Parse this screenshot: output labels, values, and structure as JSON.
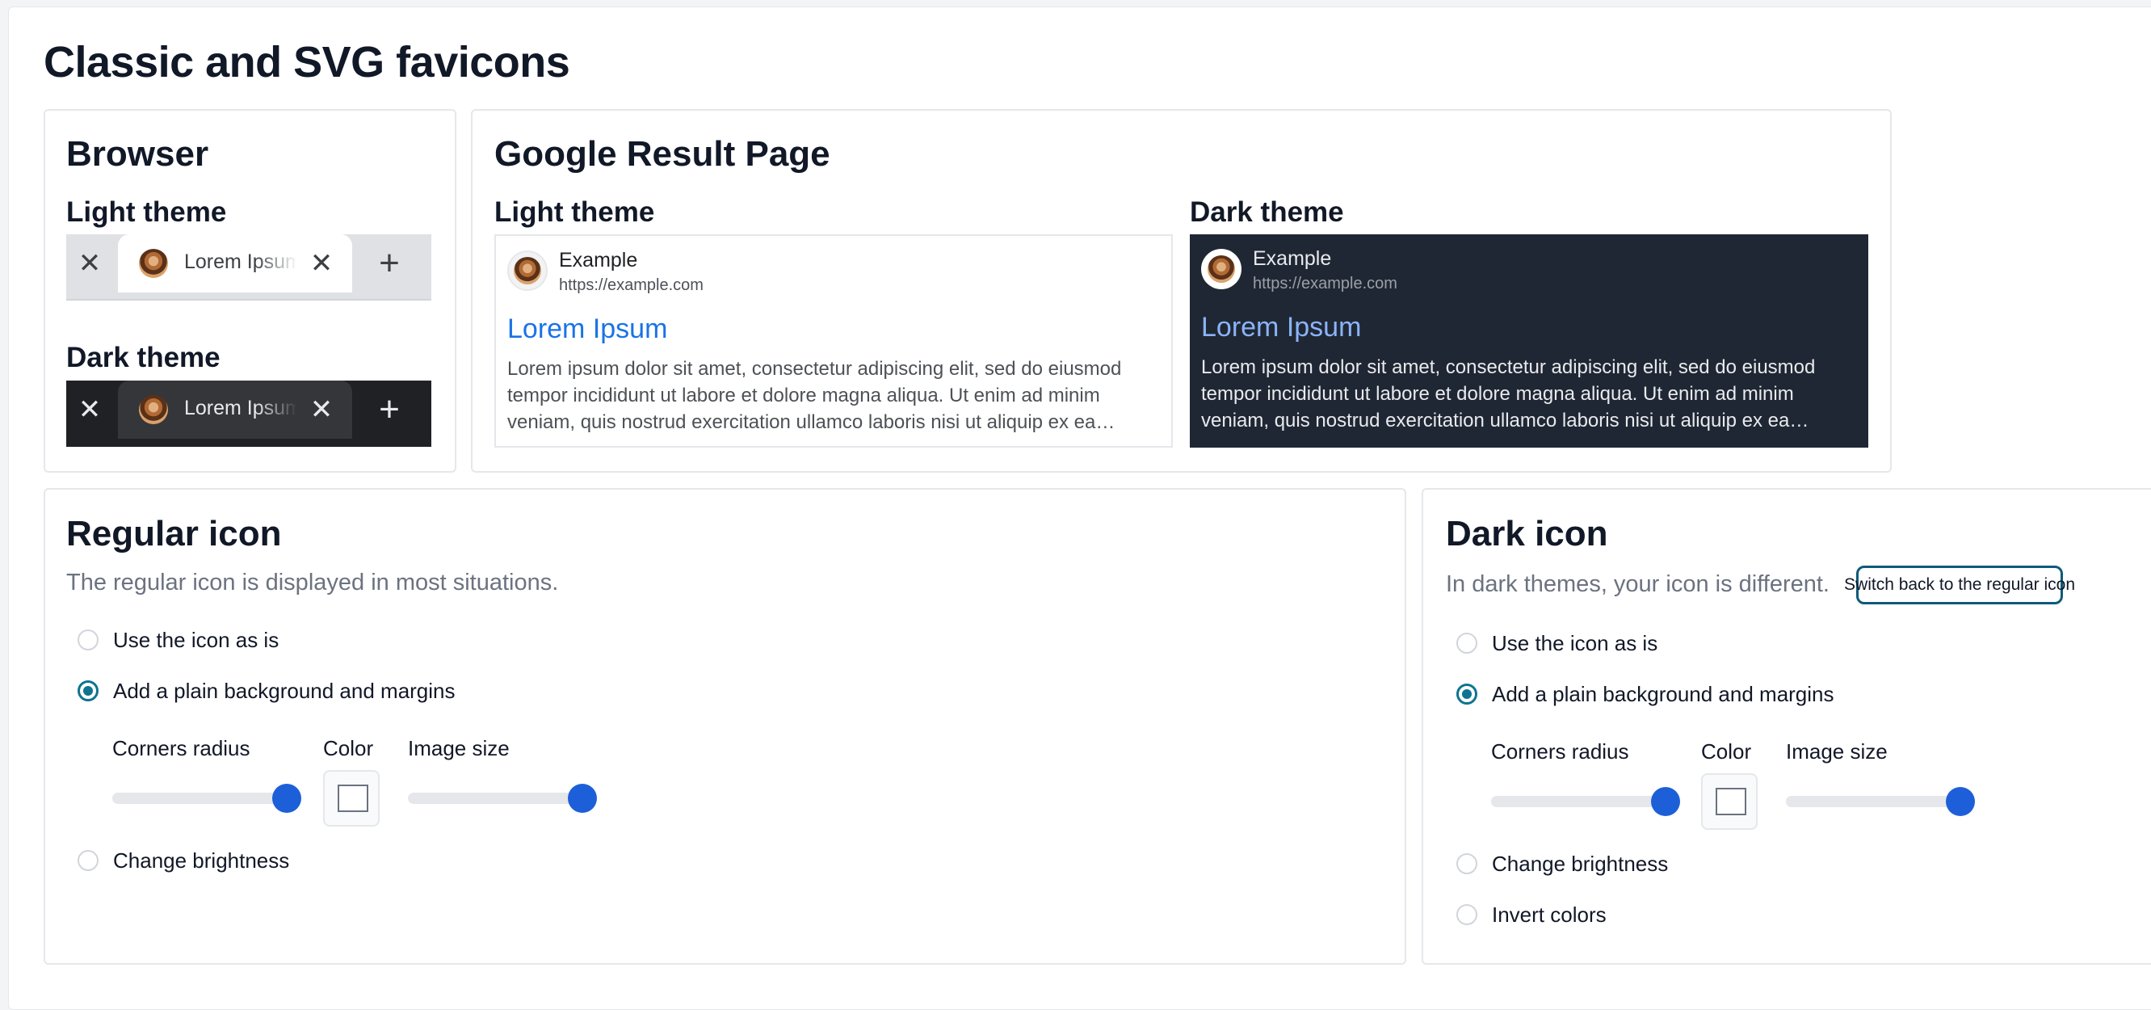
{
  "page": {
    "title": "Classic and SVG favicons"
  },
  "browser": {
    "title": "Browser",
    "light_label": "Light theme",
    "dark_label": "Dark theme",
    "tab_text": "Lorem Ipsum",
    "close_glyph": "✕",
    "plus_glyph": "+"
  },
  "google": {
    "title": "Google Result Page",
    "light_label": "Light theme",
    "dark_label": "Dark theme",
    "site_name": "Example",
    "url": "https://example.com",
    "result_title": "Lorem Ipsum",
    "snippet": "Lorem ipsum dolor sit amet, consectetur adipiscing elit, sed do eiusmod tempor incididunt ut labore et dolore magna aliqua. Ut enim ad minim veniam, quis nostrud exercitation ullamco laboris nisi ut aliquip ex ea…"
  },
  "regular": {
    "title": "Regular icon",
    "description": "The regular icon is displayed in most situations.",
    "options": [
      "Use the icon as is",
      "Add a plain background and margins",
      "Change brightness"
    ],
    "selected_option": "Add a plain background and margins",
    "corners_label": "Corners radius",
    "color_label": "Color",
    "size_label": "Image size",
    "corners_value": 1.0,
    "size_value": 1.0,
    "color_value": "#ffffff"
  },
  "dark": {
    "title": "Dark icon",
    "description": "In dark themes, your icon is different.",
    "switch_button": "Switch back to the regular icon",
    "options": [
      "Use the icon as is",
      "Add a plain background and margins",
      "Change brightness",
      "Invert colors"
    ],
    "selected_option": "Add a plain background and margins",
    "corners_label": "Corners radius",
    "color_label": "Color",
    "size_label": "Image size",
    "corners_value": 1.0,
    "size_value": 1.0,
    "color_value": "#ffffff"
  },
  "colors": {
    "radio_accent": "#0e7490",
    "slider_knob": "#1d5fd8",
    "dark_serp_bg": "#202734",
    "dark_tab_bg": "#202124"
  }
}
